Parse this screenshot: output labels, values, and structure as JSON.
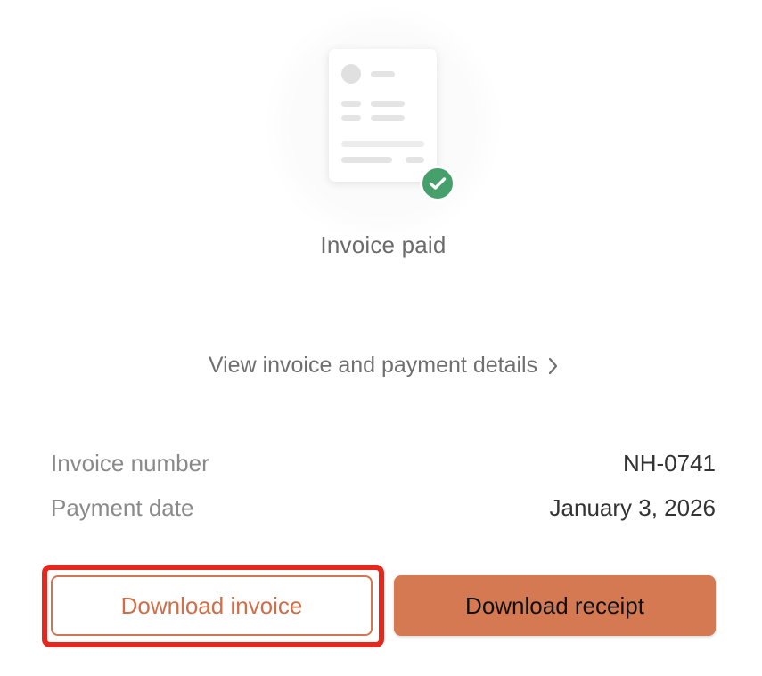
{
  "status": {
    "title": "Invoice paid",
    "badge_color": "#45a06c",
    "illustration_icon": "invoice-document-icon",
    "badge_icon": "checkmark-icon"
  },
  "details_link": {
    "label": "View invoice and payment details",
    "icon": "chevron-right-icon"
  },
  "info": [
    {
      "label": "Invoice number",
      "value": "NH-0741"
    },
    {
      "label": "Payment date",
      "value": "January 3, 2026"
    }
  ],
  "actions": {
    "download_invoice_label": "Download invoice",
    "download_receipt_label": "Download receipt",
    "accent_color": "#d57952",
    "highlight_color": "#e4281e"
  }
}
